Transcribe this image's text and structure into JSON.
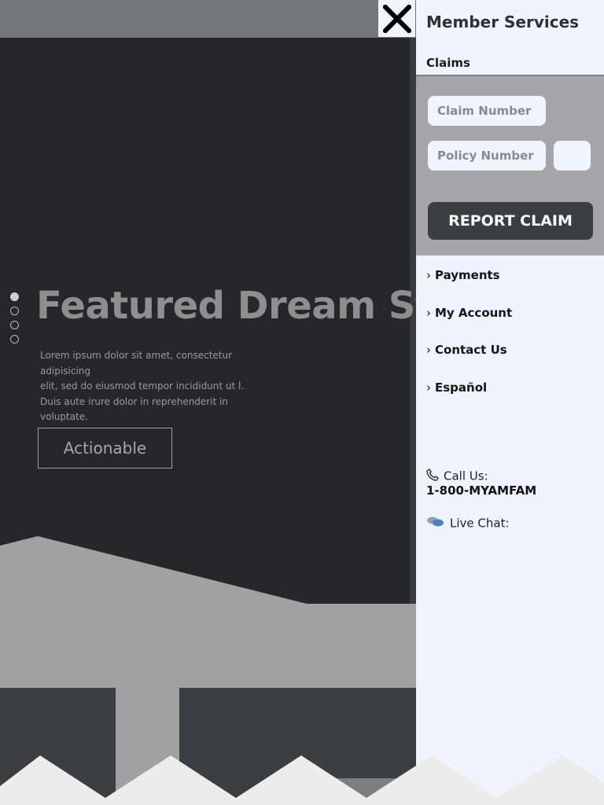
{
  "hero": {
    "title": "Featured Dream Story",
    "text_lines": [
      "Lorem ipsum dolor sit amet, consectetur adipisicing",
      "elit, sed do eiusmod tempor incididunt ut l.",
      "Duis aute irure dolor in reprehenderit in voluptate."
    ],
    "button_label": "Actionable",
    "slides": [
      "slide-1",
      "slide-2",
      "slide-3",
      "slide-4"
    ],
    "active_slide": 1
  },
  "panel": {
    "title": "Member Services",
    "subtitle": "Claims",
    "claim_placeholder": "Claim Number",
    "policy_placeholder": "Policy Number",
    "report_label": "REPORT CLAIM",
    "nav": [
      {
        "label": "Payments"
      },
      {
        "label": "My Account"
      },
      {
        "label": "Contact Us"
      },
      {
        "label": "Español"
      }
    ],
    "nav_chevron": "›",
    "call_label": "Call Us:",
    "phone": "1-800-MYAMFAM",
    "chat_label": "Live Chat:",
    "icons": {
      "close": "close-icon",
      "phone": "phone-icon",
      "chat": "chat-bubbles-icon"
    }
  },
  "colors": {
    "panel_bg": "#f0f4fe",
    "hero_bg": "#27272a",
    "button_dark": "#3d3e42"
  }
}
